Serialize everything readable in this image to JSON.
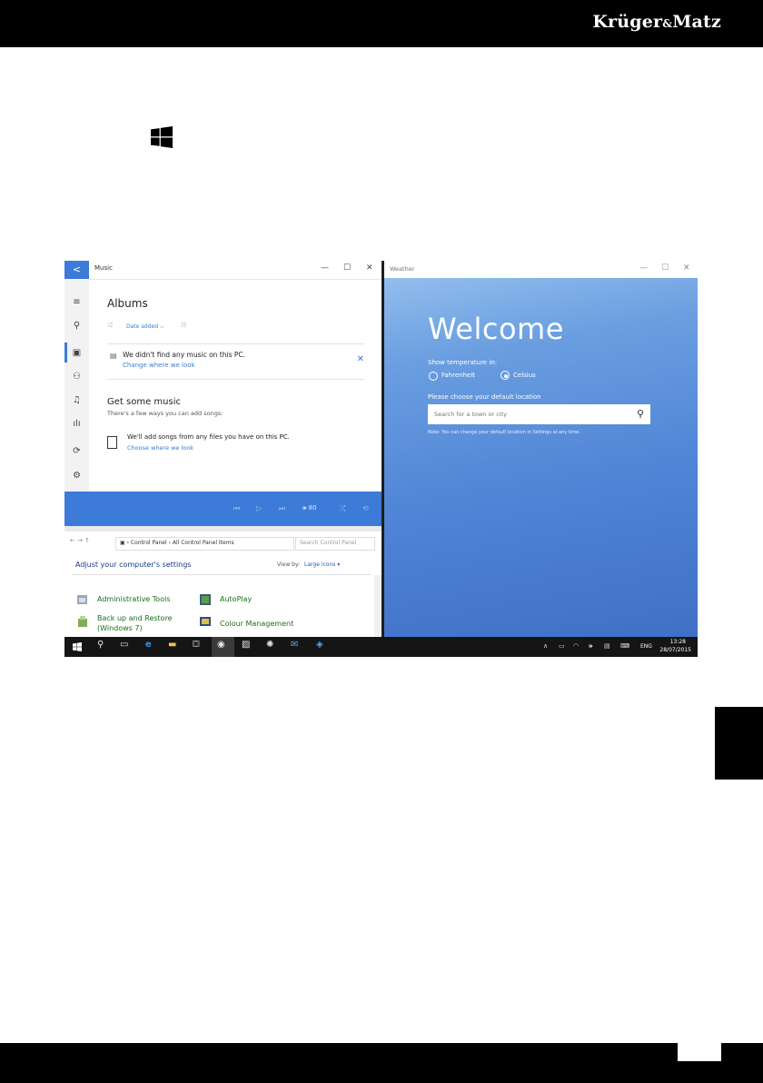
{
  "brand": {
    "name": "Krüger",
    "amp": "&",
    "name2": "Matz"
  },
  "music": {
    "title": "Music",
    "back": "<",
    "heading": "Albums",
    "filter_shuffle": "⤮",
    "filter_date": "Date added ⌵",
    "notice_text": "We didn't find any music on this PC.",
    "notice_link": "Change where we look",
    "close": "✕",
    "get_music": "Get some music",
    "get_music_sub": "There's a few ways you can add songs:",
    "add_songs": "We'll add songs from any files you have on this PC.",
    "add_link": "Choose where we look",
    "volume": "🕪 80",
    "window_controls": [
      "—",
      "☐",
      "✕"
    ],
    "rail_icons": [
      "≡",
      "⚲",
      "▣",
      "⚇",
      "♫",
      "ılı",
      "⟳",
      "⚙"
    ],
    "player_icons": [
      "⏮",
      "▷",
      "⏭",
      "⤮",
      "⟲"
    ]
  },
  "control_panel": {
    "nav": "←  →  ↑",
    "path": "▣ › Control Panel › All Control Panel Items",
    "search_placeholder": "Search Control Panel",
    "heading": "Adjust your computer's settings",
    "view_by_label": "View by:",
    "view_by_value": "Large icons ▾",
    "items": [
      {
        "label": "Administrative Tools"
      },
      {
        "label": "AutoPlay"
      },
      {
        "label": "Back up and Restore"
      },
      {
        "label": "(Windows 7)"
      },
      {
        "label": "Colour Management"
      }
    ]
  },
  "weather": {
    "title": "Weather",
    "welcome": "Welcome",
    "show_temp": "Show temperature in:",
    "fahrenheit": "Fahrenheit",
    "celsius": "Celsius",
    "selected_unit": "Celsius",
    "choose_location": "Please choose your default location",
    "search_placeholder": "Search for a town or city",
    "note": "Note: You can change your default location in Settings at any time.",
    "window_controls": [
      "—",
      "☐",
      "✕"
    ]
  },
  "taskbar": {
    "time": "13:28",
    "date": "28/07/2015",
    "language": "ENG",
    "icons": [
      "start-icon",
      "search-icon",
      "task-view-icon",
      "edge-icon",
      "explorer-icon",
      "store-icon",
      "music-icon",
      "photos-icon",
      "xbox-icon",
      "mail-icon",
      "weather-icon"
    ]
  }
}
